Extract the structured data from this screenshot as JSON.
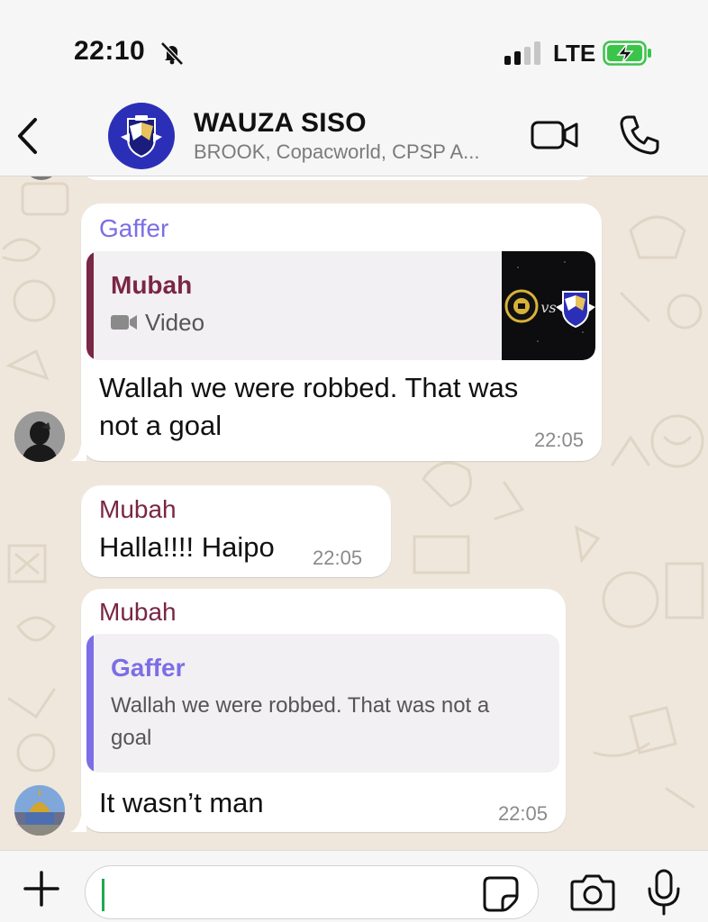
{
  "status_bar": {
    "time": "22:10",
    "network": "LTE",
    "signal_bars": 2
  },
  "header": {
    "title": "WAUZA SISO",
    "subtitle": "BROOK, Copacworld, CPSP A...",
    "icons": [
      "back-chevron-icon",
      "video-call-icon",
      "voice-call-icon"
    ]
  },
  "messages": [
    {
      "sender": "Gaffer",
      "sender_color": "#7b6ee6",
      "reply_to": {
        "name": "Mubah",
        "name_color": "#7a2645",
        "media_label": "Video",
        "thumb_vs": "vs"
      },
      "text": "Wallah we were robbed. That was not a goal",
      "text_lines": [
        "Wallah we were robbed. That was",
        "not a goal"
      ],
      "time": "22:05"
    },
    {
      "sender": "Mubah",
      "sender_color": "#7a2645",
      "text": "Halla!!!! Haipo",
      "time": "22:05"
    },
    {
      "sender": "Mubah",
      "sender_color": "#7a2645",
      "reply_to": {
        "name": "Gaffer",
        "name_color": "#7b6ee6",
        "text_lines": [
          "Wallah we were robbed. That was not a",
          "goal"
        ]
      },
      "text": "It wasn’t man",
      "time": "22:05"
    }
  ],
  "composer": {
    "value": "",
    "icons": [
      "plus-icon",
      "sticker-icon",
      "camera-icon",
      "microphone-icon"
    ]
  },
  "colors": {
    "chat_background": "#efe7dc",
    "bubble": "#ffffff",
    "group_avatar": "#2b2fb8",
    "caret": "#1fa855"
  }
}
